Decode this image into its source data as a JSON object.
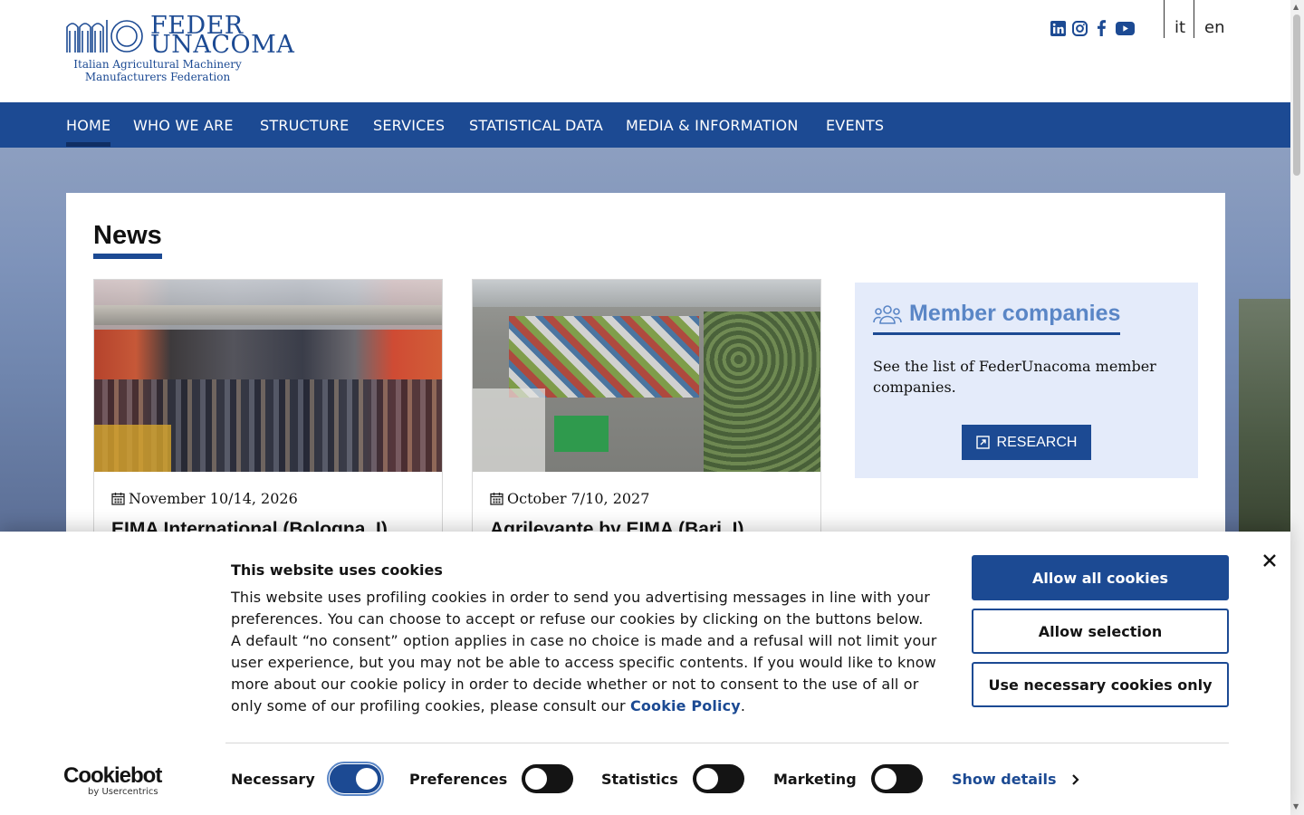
{
  "header": {
    "logo": {
      "title_line1": "FEDER",
      "title_line2": "UNACOMA",
      "subtitle_line1": "Italian Agricultural Machinery",
      "subtitle_line2": "Manufacturers Federation"
    },
    "social": [
      "linkedin-icon",
      "instagram-icon",
      "facebook-icon",
      "youtube-icon"
    ],
    "languages": [
      "it",
      "en"
    ]
  },
  "nav": {
    "items": [
      "HOME",
      "WHO WE ARE",
      "STRUCTURE",
      "SERVICES",
      "STATISTICAL DATA",
      "MEDIA & INFORMATION",
      "EVENTS"
    ],
    "active": "HOME"
  },
  "news": {
    "heading": "News",
    "cards": [
      {
        "date": "November 10/14, 2026",
        "title": "EIMA International (Bologna, I)"
      },
      {
        "date": "October 7/10, 2027",
        "title": "Agrilevante by EIMA (Bari, I)"
      }
    ]
  },
  "member": {
    "title": "Member companies",
    "text": "See the list of FederUnacoma member companies.",
    "button": "RESEARCH"
  },
  "cookie": {
    "title": "This website uses cookies",
    "text": "This website uses profiling cookies in order to send you advertising messages in line with your preferences. You can choose to accept or refuse our cookies by clicking on the buttons below. A default “no consent” option applies in case no choice is made and a refusal will not limit your user experience, but you may not be able to access specific contents. If you would like to know more about our cookie policy in order to decide whether or not to consent to the use of all or only some of our profiling cookies, please consult our",
    "link": "Cookie Policy",
    "allow_all": "Allow all cookies",
    "allow_selection": "Allow selection",
    "necessary_only": "Use necessary cookies only",
    "toggles": [
      {
        "label": "Necessary",
        "on": true
      },
      {
        "label": "Preferences",
        "on": false
      },
      {
        "label": "Statistics",
        "on": false
      },
      {
        "label": "Marketing",
        "on": false
      }
    ],
    "show_details": "Show details",
    "brand": "Cookiebot",
    "brand_sub": "by Usercentrics"
  },
  "colors": {
    "brand": "#1c4a93",
    "member_bg": "#e4ebfa",
    "member_title": "#5a86c6"
  }
}
